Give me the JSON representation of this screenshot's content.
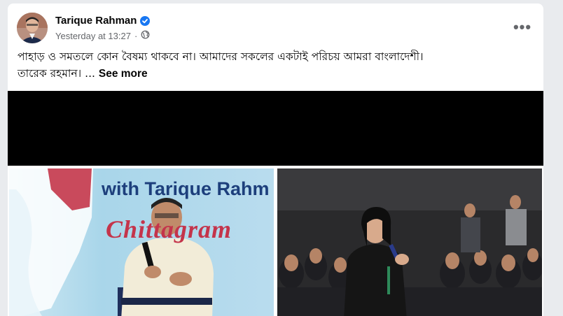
{
  "post": {
    "author": "Tarique Rahman",
    "timestamp": "Yesterday at 13:27",
    "separator": "·",
    "audience_icon": "globe-icon",
    "verified_icon": "verified-badge-icon",
    "text_line1": "পাহাড় ও সমতলে কোন বৈষম্য থাকবে না। আমাদের সকলের একটাই পরিচয় আমরা বাংলাদেশী।",
    "text_line2": "তারেক রহমান। ...",
    "see_more": "See more",
    "more_options_label": "•••"
  },
  "media": {
    "left_banner_title": "with Tarique Rahm",
    "left_banner_city": "Chittagram"
  },
  "colors": {
    "brand_blue": "#1877f2",
    "secondary_text": "#65676b",
    "banner_blue": "#1d3f7c",
    "banner_red": "#c4344b"
  }
}
